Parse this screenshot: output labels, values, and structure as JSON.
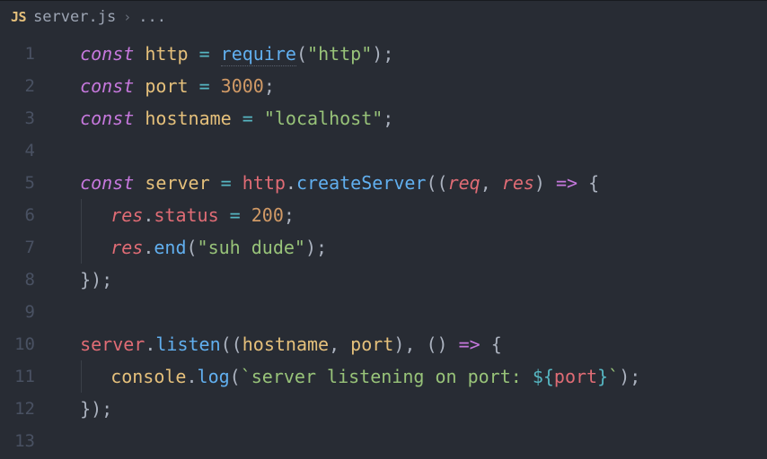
{
  "breadcrumb": {
    "icon_label": "JS",
    "filename": "server.js",
    "chevron": "›",
    "ellipsis": "..."
  },
  "gutter": [
    "1",
    "2",
    "3",
    "4",
    "5",
    "6",
    "7",
    "8",
    "9",
    "10",
    "11",
    "12",
    "13"
  ],
  "code": {
    "l1": {
      "kw": "const",
      "sp": " ",
      "var": "http",
      "sp2": " ",
      "op": "=",
      "sp3": " ",
      "fn": "require",
      "p1": "(",
      "q1": "\"",
      "s1": "http",
      "q2": "\"",
      "p2": ")",
      "semi": ";"
    },
    "l2": {
      "kw": "const",
      "sp": " ",
      "var": "port",
      "sp2": " ",
      "op": "=",
      "sp3": " ",
      "num": "3000",
      "semi": ";"
    },
    "l3": {
      "kw": "const",
      "sp": " ",
      "var": "hostname",
      "sp2": " ",
      "op": "=",
      "sp3": " ",
      "q1": "\"",
      "s1": "localhost",
      "q2": "\"",
      "semi": ";"
    },
    "l5": {
      "kw": "const",
      "sp": " ",
      "var": "server",
      "sp2": " ",
      "op": "=",
      "sp3": " ",
      "obj": "http",
      "dot": ".",
      "fn": "createServer",
      "p1": "((",
      "param1": "req",
      "comma": ", ",
      "param2": "res",
      "p2": ") ",
      "arrow": "=>",
      "sp4": " ",
      "brace": "{"
    },
    "l6": {
      "indent": "  ",
      "obj": "res",
      "dot": ".",
      "prop": "status",
      "sp": " ",
      "op": "=",
      "sp2": " ",
      "num": "200",
      "semi": ";"
    },
    "l7": {
      "indent": "  ",
      "obj": "res",
      "dot": ".",
      "fn": "end",
      "p1": "(",
      "q1": "\"",
      "s1": "suh dude",
      "q2": "\"",
      "p2": ")",
      "semi": ";"
    },
    "l8": {
      "close": "});"
    },
    "l10": {
      "obj": "server",
      "dot": ".",
      "fn": "listen",
      "p1": "((",
      "v1": "hostname",
      "comma": ", ",
      "v2": "port",
      "p2": "), () ",
      "arrow": "=>",
      "sp": " ",
      "brace": "{"
    },
    "l11": {
      "indent": "  ",
      "obj": "console",
      "dot": ".",
      "fn": "log",
      "p1": "(",
      "bt1": "`",
      "s1": "server listening on port: ",
      "tmpl1": "${",
      "v1": "port",
      "tmpl2": "}",
      "bt2": "`",
      "p2": ")",
      "semi": ";"
    },
    "l12": {
      "close": "});"
    }
  }
}
